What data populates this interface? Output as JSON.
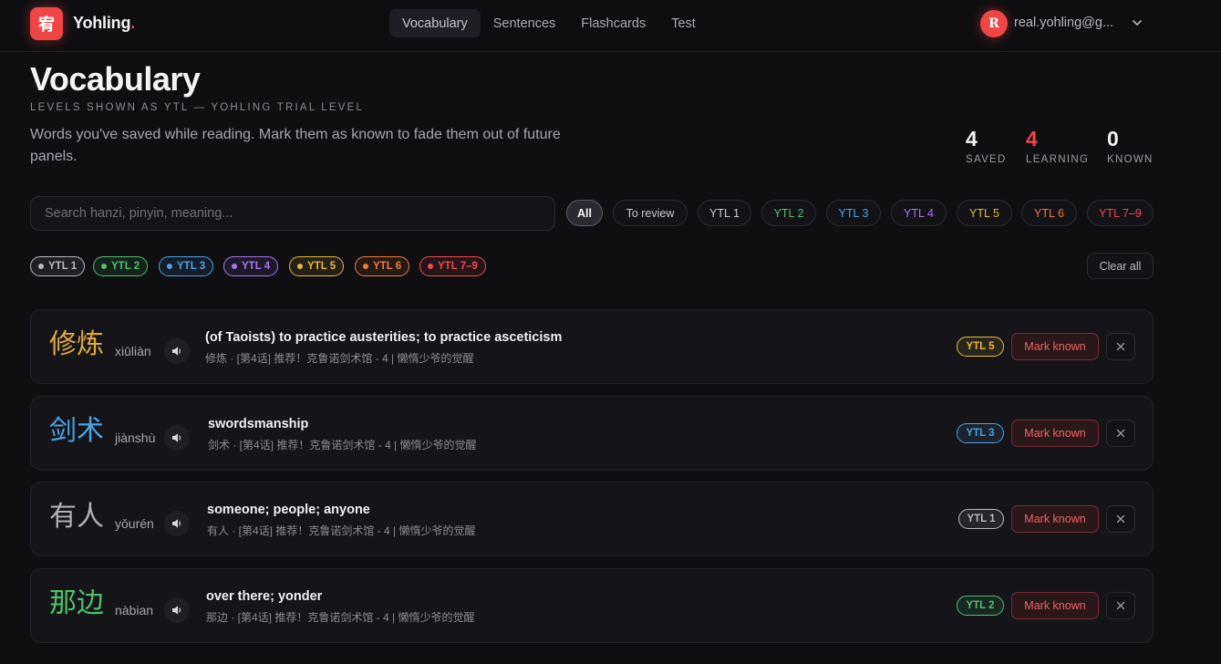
{
  "app": {
    "logo_glyph": "宥",
    "name": "Yohling",
    "name_dot": "."
  },
  "nav": [
    {
      "label": "Vocabulary",
      "active": true
    },
    {
      "label": "Sentences",
      "active": false
    },
    {
      "label": "Flashcards",
      "active": false
    },
    {
      "label": "Test",
      "active": false
    }
  ],
  "user": {
    "initial": "R",
    "email": "real.yohling@g...",
    "menu_icon": "chevron-down-icon"
  },
  "header": {
    "title": "Vocabulary",
    "subtitle": "LEVELS SHOWN AS YTL — YOHLING TRIAL LEVEL",
    "description": "Words you've saved while reading. Mark them as known to fade them out of future panels."
  },
  "stats": [
    {
      "value": "4",
      "label": "SAVED"
    },
    {
      "value": "4",
      "label": "LEARNING"
    },
    {
      "value": "0",
      "label": "KNOWN"
    }
  ],
  "search": {
    "placeholder": "Search hanzi, pinyin, meaning...",
    "value": ""
  },
  "filters": [
    {
      "label": "All",
      "active": true,
      "color": "#f2f2f4"
    },
    {
      "label": "To review",
      "active": false,
      "color": "#c9c9d0"
    },
    {
      "label": "YTL 1",
      "active": false,
      "color": "#c9c9d0"
    },
    {
      "label": "YTL 2",
      "active": false,
      "color": "#4cc36b"
    },
    {
      "label": "YTL 3",
      "active": false,
      "color": "#4aa3e8"
    },
    {
      "label": "YTL 4",
      "active": false,
      "color": "#a774f0"
    },
    {
      "label": "YTL 5",
      "active": false,
      "color": "#e8b73c"
    },
    {
      "label": "YTL 6",
      "active": false,
      "color": "#ef7a3a"
    },
    {
      "label": "YTL 7–9",
      "active": false,
      "color": "#ef4b4b"
    }
  ],
  "level_tags": [
    {
      "label": "YTL 1",
      "color": "#b9b9c1"
    },
    {
      "label": "YTL 2",
      "color": "#4cc36b"
    },
    {
      "label": "YTL 3",
      "color": "#4aa3e8"
    },
    {
      "label": "YTL 4",
      "color": "#a774f0"
    },
    {
      "label": "YTL 5",
      "color": "#e8b73c"
    },
    {
      "label": "YTL 6",
      "color": "#ef7a3a"
    },
    {
      "label": "YTL 7–9",
      "color": "#ef4b4b"
    }
  ],
  "clear_all_label": "Clear all",
  "words": [
    {
      "hanzi": "修炼",
      "hanzi_color": "#e0a93c",
      "pinyin": "xiūliàn",
      "meaning": "(of Taoists) to practice austerities; to practice asceticism",
      "source": "修炼  ·  [第4话] 推荐！克鲁诺剑术馆 - 4 | 懒惰少爷的觉醒",
      "level": "YTL 5",
      "level_color": "#e8b73c",
      "mark_label": "Mark known"
    },
    {
      "hanzi": "剑术",
      "hanzi_color": "#4aa3e8",
      "pinyin": "jiànshù",
      "meaning": "swordsmanship",
      "source": "剑术  ·  [第4话] 推荐！克鲁诺剑术馆 - 4 | 懒惰少爷的觉醒",
      "level": "YTL 3",
      "level_color": "#4aa3e8",
      "mark_label": "Mark known"
    },
    {
      "hanzi": "有人",
      "hanzi_color": "#b0b0b8",
      "pinyin": "yǒurén",
      "meaning": "someone; people; anyone",
      "source": "有人  ·  [第4话] 推荐！克鲁诺剑术馆 - 4 | 懒惰少爷的觉醒",
      "level": "YTL 1",
      "level_color": "#b9b9c1",
      "mark_label": "Mark known"
    },
    {
      "hanzi": "那边",
      "hanzi_color": "#4cc36b",
      "pinyin": "nàbian",
      "meaning": "over there; yonder",
      "source": "那边  ·  [第4话] 推荐！克鲁诺剑术馆 - 4 | 懒惰少爷的觉醒",
      "level": "YTL 2",
      "level_color": "#4cc36b",
      "mark_label": "Mark known"
    }
  ],
  "icons": {
    "sound": "speaker-icon",
    "remove": "close-icon"
  },
  "colors": {
    "accent": "#f04545",
    "background": "#0f0f12",
    "card": "#151519"
  }
}
